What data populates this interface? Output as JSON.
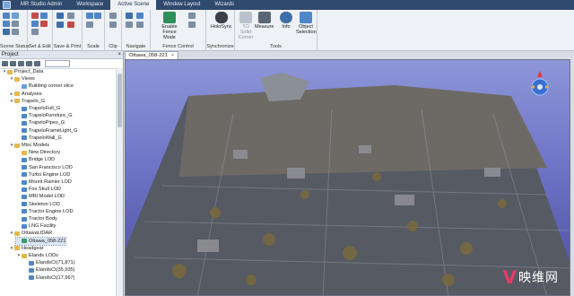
{
  "app": {
    "title": "MR Studio Admin",
    "tabs": [
      "Workspace",
      "Active Scene",
      "Window Layout",
      "Wizards"
    ],
    "active_tab": "Active Scene"
  },
  "ribbon": {
    "groups": [
      "Scene Status",
      "Set & Edit",
      "Save & Print",
      "Scale",
      "Clip",
      "Navigate",
      "Fence Control",
      "Synchronize",
      "Tools"
    ],
    "buttons": {
      "enable_fence_mode": "Enable Fence Mode",
      "holosync": "HoloSync",
      "to_solid_corner": "TO Solid Corner",
      "measure": "Measure",
      "info": "Info",
      "object_selection": "Object Selection"
    }
  },
  "project_panel": {
    "title": "Project",
    "close": "×",
    "tree": [
      {
        "label": "Project_Data",
        "level": 0,
        "expanded": true,
        "icon": "folder"
      },
      {
        "label": "Views",
        "level": 1,
        "expanded": true,
        "icon": "folder"
      },
      {
        "label": "Building corner slice",
        "level": 2,
        "icon": "view"
      },
      {
        "label": "Analyses",
        "level": 1,
        "expanded": false,
        "icon": "folder"
      },
      {
        "label": "Trapelo_G",
        "level": 1,
        "expanded": true,
        "icon": "folder"
      },
      {
        "label": "TrapeloFull_G",
        "level": 2,
        "icon": "model"
      },
      {
        "label": "TrapeloFurniture_G",
        "level": 2,
        "icon": "model"
      },
      {
        "label": "TrapeloPipes_G",
        "level": 2,
        "icon": "model"
      },
      {
        "label": "TrapeloFrameLight_G",
        "level": 2,
        "icon": "model"
      },
      {
        "label": "TrapeloWall_G",
        "level": 2,
        "icon": "model"
      },
      {
        "label": "Misc Models",
        "level": 1,
        "expanded": true,
        "icon": "folder"
      },
      {
        "label": "New Directory",
        "level": 2,
        "icon": "folder"
      },
      {
        "label": "Bridge LOD",
        "level": 2,
        "icon": "model"
      },
      {
        "label": "San Francisco LOD",
        "level": 2,
        "icon": "model"
      },
      {
        "label": "Turbo Engine LOD",
        "level": 2,
        "icon": "model"
      },
      {
        "label": "Mount Rainier LOD",
        "level": 2,
        "icon": "model"
      },
      {
        "label": "Fox Skull LOD",
        "level": 2,
        "icon": "model"
      },
      {
        "label": "MRI Model LOD",
        "level": 2,
        "icon": "model"
      },
      {
        "label": "Skeleton LOD",
        "level": 2,
        "icon": "model"
      },
      {
        "label": "Tractor Engine LOD",
        "level": 2,
        "icon": "model"
      },
      {
        "label": "Tractor Body",
        "level": 2,
        "icon": "model"
      },
      {
        "label": "LNG Facility",
        "level": 2,
        "icon": "model"
      },
      {
        "label": "OttawaLIDAR",
        "level": 1,
        "expanded": true,
        "icon": "folder"
      },
      {
        "label": "Ottawa_058-221",
        "level": 2,
        "icon": "lidar",
        "selected": true
      },
      {
        "label": "Headgear",
        "level": 1,
        "expanded": true,
        "icon": "folder"
      },
      {
        "label": "Elands LODs",
        "level": 2,
        "expanded": true,
        "icon": "folder"
      },
      {
        "label": "ElandsCt(71,871)",
        "level": 3,
        "icon": "model"
      },
      {
        "label": "ElandsCt(35,935)",
        "level": 3,
        "icon": "model"
      },
      {
        "label": "ElandsCt(17,967)",
        "level": 3,
        "icon": "model"
      }
    ]
  },
  "viewport": {
    "tab_label": "Ottawa_058-221",
    "tab_close": "×",
    "watermark_logo": "V",
    "watermark_text": "映维网"
  },
  "colors": {
    "topbar": "#2f4a6d",
    "ribbon": "#eef1f5",
    "sky_top": "#8d96d8",
    "sky_bottom": "#4b4f9e",
    "folder": "#e4b84a",
    "watermark_accent": "#e23b6a"
  }
}
